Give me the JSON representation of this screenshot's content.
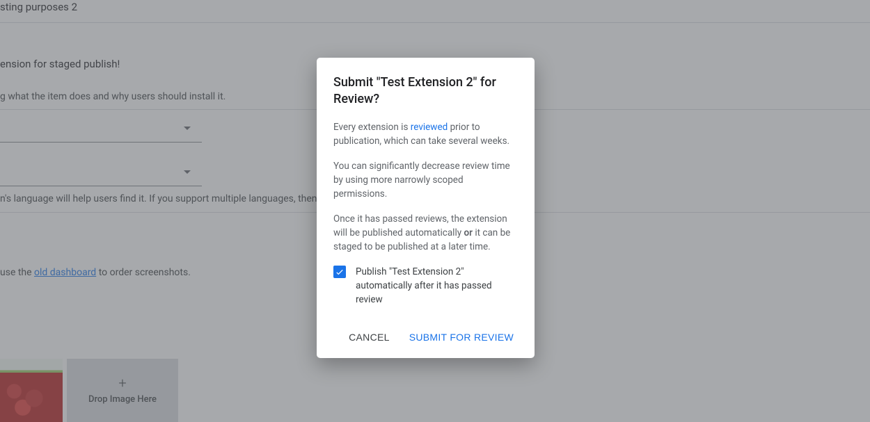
{
  "background": {
    "field_title_1": "sting purposes 2",
    "field_title_2": "ension for staged publish!",
    "help_description": "g what the item does and why users should install it.",
    "help_language_pre": "n's language will help users find it. If you support multiple languages, then you sh",
    "help_screenshots_pre": "use the ",
    "help_screenshots_link": "old dashboard",
    "help_screenshots_post": " to order screenshots.",
    "drop_label": "Drop Image Here"
  },
  "dialog": {
    "title": "Submit \"Test Extension 2\" for Review?",
    "p1_pre": "Every extension is ",
    "p1_link": "reviewed",
    "p1_post": " prior to publication, which can take several weeks.",
    "p2": "You can significantly decrease review time by using more narrowly scoped permissions.",
    "p3_pre": "Once it has passed reviews, the extension will be published automatically ",
    "p3_strong": "or",
    "p3_post": " it can be staged to be published at a later time.",
    "checkbox_label": "Publish \"Test Extension 2\" automatically after it has passed review",
    "checkbox_checked": true,
    "cancel_label": "CANCEL",
    "submit_label": "SUBMIT FOR REVIEW"
  }
}
